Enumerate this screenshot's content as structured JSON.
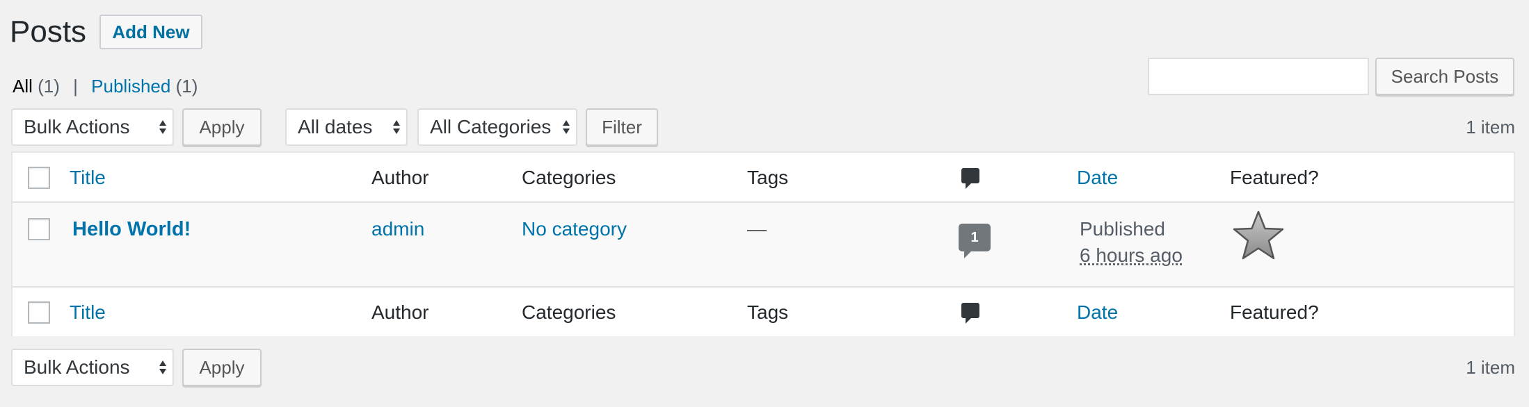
{
  "page": {
    "title": "Posts",
    "add_new_label": "Add New"
  },
  "filters": {
    "all_label": "All",
    "all_count": "(1)",
    "separator": "|",
    "published_label": "Published",
    "published_count": "(1)"
  },
  "search": {
    "value": "",
    "button_label": "Search Posts"
  },
  "toolbar_top": {
    "bulk_actions": "Bulk Actions",
    "apply_label": "Apply",
    "dates": "All dates",
    "categories": "All Categories",
    "filter_label": "Filter",
    "item_count": "1 item"
  },
  "table": {
    "columns": {
      "title": "Title",
      "author": "Author",
      "categories": "Categories",
      "tags": "Tags",
      "comments_icon": "comment-icon",
      "date": "Date",
      "featured": "Featured?"
    },
    "rows": [
      {
        "title": "Hello World!",
        "author": "admin",
        "categories": "No category",
        "tags": "—",
        "comments": "1",
        "date_status": "Published",
        "date_ago": "6 hours ago",
        "featured_icon": "star-icon"
      }
    ]
  },
  "toolbar_bottom": {
    "bulk_actions": "Bulk Actions",
    "apply_label": "Apply",
    "item_count": "1 item"
  },
  "colors": {
    "link": "#0073aa",
    "background": "#f1f1f1",
    "text": "#23282d"
  }
}
